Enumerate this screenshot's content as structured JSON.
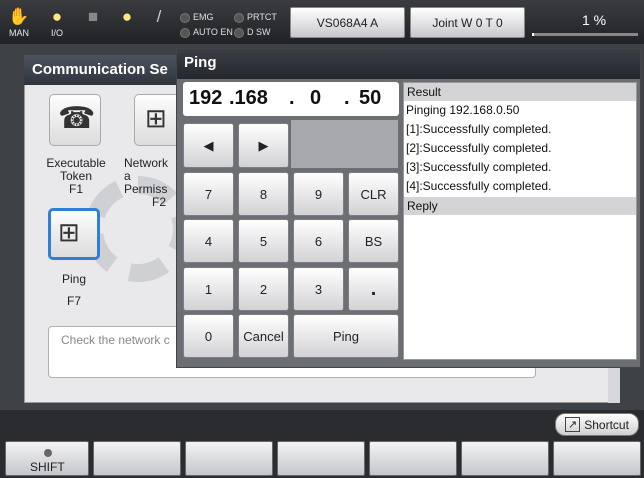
{
  "topbar": {
    "man_label": "MAN",
    "io_label": "I/O",
    "lamps": [
      "EMG",
      "PRTCT",
      "AUTO EN",
      "D SW"
    ],
    "robot_button": "VS068A4 A",
    "joint_button": "Joint  W 0 T 0",
    "speed_percent": "1 %"
  },
  "window": {
    "title": "Communication Se"
  },
  "apps": [
    {
      "label_line1": "Executable",
      "label_line2": "Token",
      "key": "F1",
      "icon": "phone-key-icon"
    },
    {
      "label_line1": "Network a",
      "label_line2": "Permiss",
      "key": "F2",
      "icon": "network-icon"
    },
    {
      "label_line1": "Ping",
      "label_line2": "",
      "key": "F7",
      "icon": "ping-network-icon"
    }
  ],
  "description": "Check the network c",
  "ping_dialog": {
    "title": "Ping",
    "ip": [
      "192",
      ".168",
      ".",
      "0",
      ".",
      "50"
    ],
    "keys": {
      "left": "◀",
      "right": "▶",
      "k7": "7",
      "k8": "8",
      "k9": "9",
      "clr": "CLR",
      "k4": "4",
      "k5": "5",
      "k6": "6",
      "bs": "BS",
      "k1": "1",
      "k2": "2",
      "k3": "3",
      "dot": ".",
      "k0": "0",
      "cancel": "Cancel",
      "ping": "Ping"
    },
    "result_header": "Result",
    "result_lines": [
      "Pinging 192.168.0.50",
      "[1]:Successfully completed.",
      "[2]:Successfully completed.",
      "[3]:Successfully completed.",
      "[4]:Successfully completed."
    ],
    "reply_header": "Reply"
  },
  "bottom": {
    "shortcut_label": "Shortcut",
    "shift_label": "SHIFT"
  },
  "colors": {
    "panel_header": "#3a3f48",
    "selected_border": "#2f7fd6",
    "dialog_bg": "#6b6e73"
  }
}
